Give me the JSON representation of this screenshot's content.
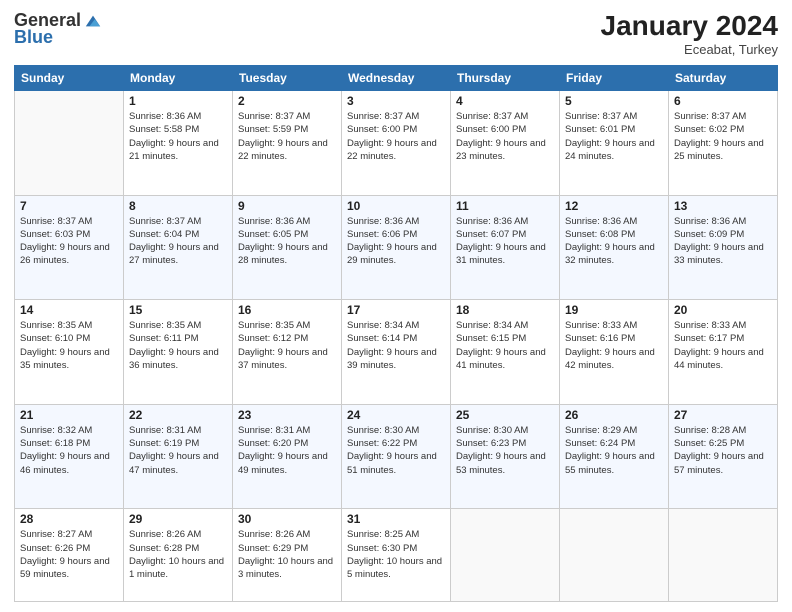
{
  "header": {
    "logo_general": "General",
    "logo_blue": "Blue",
    "month_title": "January 2024",
    "location": "Eceabat, Turkey"
  },
  "weekdays": [
    "Sunday",
    "Monday",
    "Tuesday",
    "Wednesday",
    "Thursday",
    "Friday",
    "Saturday"
  ],
  "weeks": [
    [
      {
        "day": "",
        "sunrise": "",
        "sunset": "",
        "daylight": ""
      },
      {
        "day": "1",
        "sunrise": "Sunrise: 8:36 AM",
        "sunset": "Sunset: 5:58 PM",
        "daylight": "Daylight: 9 hours and 21 minutes."
      },
      {
        "day": "2",
        "sunrise": "Sunrise: 8:37 AM",
        "sunset": "Sunset: 5:59 PM",
        "daylight": "Daylight: 9 hours and 22 minutes."
      },
      {
        "day": "3",
        "sunrise": "Sunrise: 8:37 AM",
        "sunset": "Sunset: 6:00 PM",
        "daylight": "Daylight: 9 hours and 22 minutes."
      },
      {
        "day": "4",
        "sunrise": "Sunrise: 8:37 AM",
        "sunset": "Sunset: 6:00 PM",
        "daylight": "Daylight: 9 hours and 23 minutes."
      },
      {
        "day": "5",
        "sunrise": "Sunrise: 8:37 AM",
        "sunset": "Sunset: 6:01 PM",
        "daylight": "Daylight: 9 hours and 24 minutes."
      },
      {
        "day": "6",
        "sunrise": "Sunrise: 8:37 AM",
        "sunset": "Sunset: 6:02 PM",
        "daylight": "Daylight: 9 hours and 25 minutes."
      }
    ],
    [
      {
        "day": "7",
        "sunrise": "Sunrise: 8:37 AM",
        "sunset": "Sunset: 6:03 PM",
        "daylight": "Daylight: 9 hours and 26 minutes."
      },
      {
        "day": "8",
        "sunrise": "Sunrise: 8:37 AM",
        "sunset": "Sunset: 6:04 PM",
        "daylight": "Daylight: 9 hours and 27 minutes."
      },
      {
        "day": "9",
        "sunrise": "Sunrise: 8:36 AM",
        "sunset": "Sunset: 6:05 PM",
        "daylight": "Daylight: 9 hours and 28 minutes."
      },
      {
        "day": "10",
        "sunrise": "Sunrise: 8:36 AM",
        "sunset": "Sunset: 6:06 PM",
        "daylight": "Daylight: 9 hours and 29 minutes."
      },
      {
        "day": "11",
        "sunrise": "Sunrise: 8:36 AM",
        "sunset": "Sunset: 6:07 PM",
        "daylight": "Daylight: 9 hours and 31 minutes."
      },
      {
        "day": "12",
        "sunrise": "Sunrise: 8:36 AM",
        "sunset": "Sunset: 6:08 PM",
        "daylight": "Daylight: 9 hours and 32 minutes."
      },
      {
        "day": "13",
        "sunrise": "Sunrise: 8:36 AM",
        "sunset": "Sunset: 6:09 PM",
        "daylight": "Daylight: 9 hours and 33 minutes."
      }
    ],
    [
      {
        "day": "14",
        "sunrise": "Sunrise: 8:35 AM",
        "sunset": "Sunset: 6:10 PM",
        "daylight": "Daylight: 9 hours and 35 minutes."
      },
      {
        "day": "15",
        "sunrise": "Sunrise: 8:35 AM",
        "sunset": "Sunset: 6:11 PM",
        "daylight": "Daylight: 9 hours and 36 minutes."
      },
      {
        "day": "16",
        "sunrise": "Sunrise: 8:35 AM",
        "sunset": "Sunset: 6:12 PM",
        "daylight": "Daylight: 9 hours and 37 minutes."
      },
      {
        "day": "17",
        "sunrise": "Sunrise: 8:34 AM",
        "sunset": "Sunset: 6:14 PM",
        "daylight": "Daylight: 9 hours and 39 minutes."
      },
      {
        "day": "18",
        "sunrise": "Sunrise: 8:34 AM",
        "sunset": "Sunset: 6:15 PM",
        "daylight": "Daylight: 9 hours and 41 minutes."
      },
      {
        "day": "19",
        "sunrise": "Sunrise: 8:33 AM",
        "sunset": "Sunset: 6:16 PM",
        "daylight": "Daylight: 9 hours and 42 minutes."
      },
      {
        "day": "20",
        "sunrise": "Sunrise: 8:33 AM",
        "sunset": "Sunset: 6:17 PM",
        "daylight": "Daylight: 9 hours and 44 minutes."
      }
    ],
    [
      {
        "day": "21",
        "sunrise": "Sunrise: 8:32 AM",
        "sunset": "Sunset: 6:18 PM",
        "daylight": "Daylight: 9 hours and 46 minutes."
      },
      {
        "day": "22",
        "sunrise": "Sunrise: 8:31 AM",
        "sunset": "Sunset: 6:19 PM",
        "daylight": "Daylight: 9 hours and 47 minutes."
      },
      {
        "day": "23",
        "sunrise": "Sunrise: 8:31 AM",
        "sunset": "Sunset: 6:20 PM",
        "daylight": "Daylight: 9 hours and 49 minutes."
      },
      {
        "day": "24",
        "sunrise": "Sunrise: 8:30 AM",
        "sunset": "Sunset: 6:22 PM",
        "daylight": "Daylight: 9 hours and 51 minutes."
      },
      {
        "day": "25",
        "sunrise": "Sunrise: 8:30 AM",
        "sunset": "Sunset: 6:23 PM",
        "daylight": "Daylight: 9 hours and 53 minutes."
      },
      {
        "day": "26",
        "sunrise": "Sunrise: 8:29 AM",
        "sunset": "Sunset: 6:24 PM",
        "daylight": "Daylight: 9 hours and 55 minutes."
      },
      {
        "day": "27",
        "sunrise": "Sunrise: 8:28 AM",
        "sunset": "Sunset: 6:25 PM",
        "daylight": "Daylight: 9 hours and 57 minutes."
      }
    ],
    [
      {
        "day": "28",
        "sunrise": "Sunrise: 8:27 AM",
        "sunset": "Sunset: 6:26 PM",
        "daylight": "Daylight: 9 hours and 59 minutes."
      },
      {
        "day": "29",
        "sunrise": "Sunrise: 8:26 AM",
        "sunset": "Sunset: 6:28 PM",
        "daylight": "Daylight: 10 hours and 1 minute."
      },
      {
        "day": "30",
        "sunrise": "Sunrise: 8:26 AM",
        "sunset": "Sunset: 6:29 PM",
        "daylight": "Daylight: 10 hours and 3 minutes."
      },
      {
        "day": "31",
        "sunrise": "Sunrise: 8:25 AM",
        "sunset": "Sunset: 6:30 PM",
        "daylight": "Daylight: 10 hours and 5 minutes."
      },
      {
        "day": "",
        "sunrise": "",
        "sunset": "",
        "daylight": ""
      },
      {
        "day": "",
        "sunrise": "",
        "sunset": "",
        "daylight": ""
      },
      {
        "day": "",
        "sunrise": "",
        "sunset": "",
        "daylight": ""
      }
    ]
  ]
}
